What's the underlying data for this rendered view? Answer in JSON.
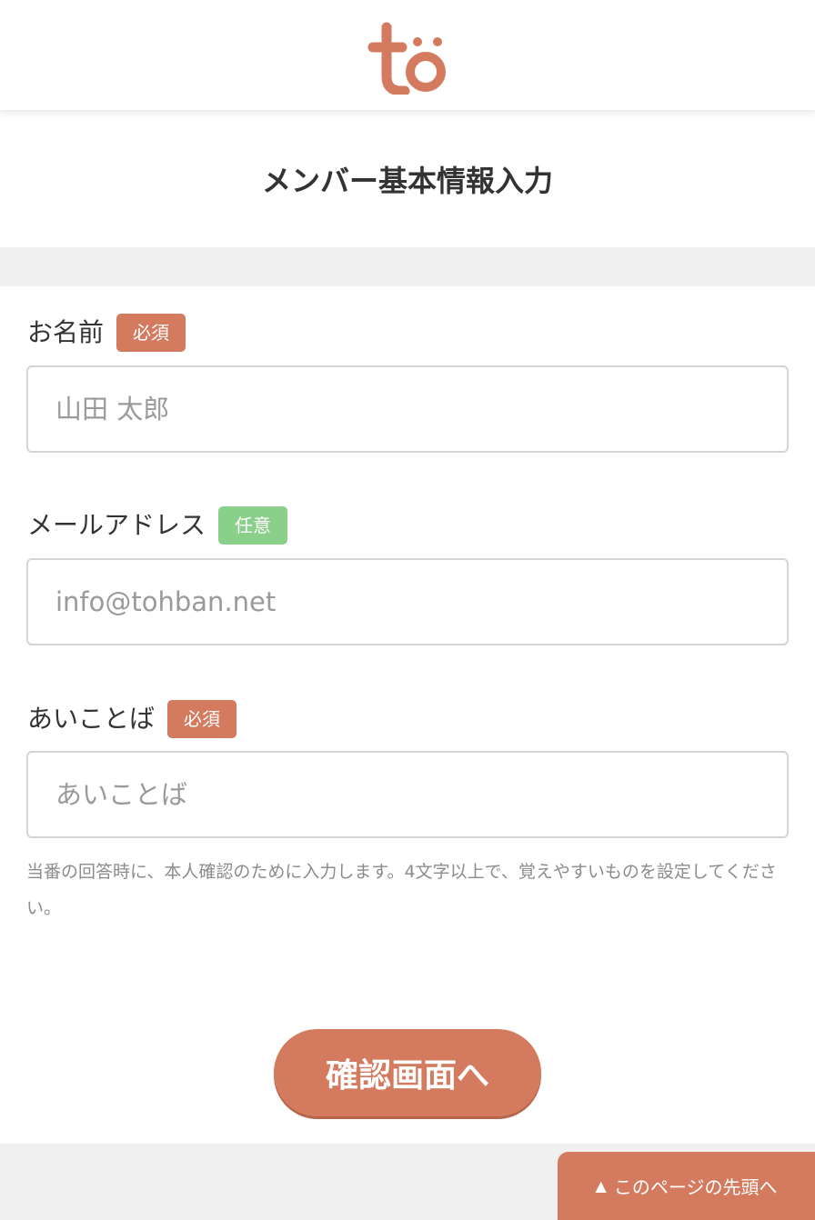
{
  "brand": {
    "logo_text": "tö",
    "accent_color": "#d47b5f",
    "optional_color": "#8bd08a"
  },
  "page": {
    "title": "メンバー基本情報入力"
  },
  "form": {
    "fields": [
      {
        "label": "お名前",
        "badge": "必須",
        "placeholder": "山田 太郎",
        "value": ""
      },
      {
        "label": "メールアドレス",
        "badge": "任意",
        "placeholder": "info@tohban.net",
        "value": ""
      },
      {
        "label": "あいことば",
        "badge": "必須",
        "placeholder": "あいことば",
        "value": ""
      }
    ],
    "passphrase_hint": "当番の回答時に、本人確認のために入力します。4文字以上で、覚えやすいものを設定してください。",
    "confirm_label": "確認画面へ"
  },
  "footer": {
    "back_to_top_label": "このページの先頭へ",
    "back_to_top_icon": "triangle-up-icon"
  }
}
